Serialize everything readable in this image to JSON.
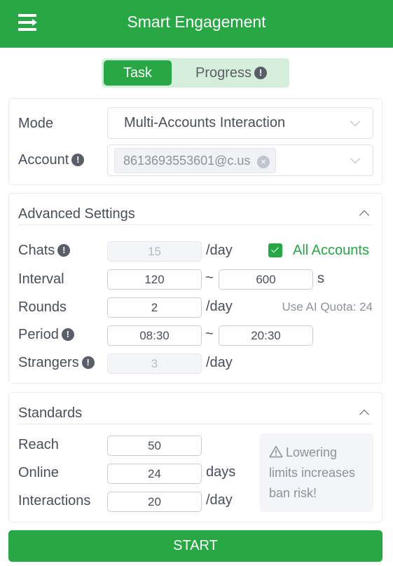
{
  "header": {
    "title": "Smart Engagement",
    "menu_icon": "menu-expand-icon"
  },
  "tabs": [
    {
      "label": "Task",
      "active": true
    },
    {
      "label": "Progress",
      "active": false,
      "badge": "!"
    }
  ],
  "basic": {
    "mode_label": "Mode",
    "mode_value": "Multi-Accounts Interaction",
    "account_label": "Account",
    "account_badge": "!",
    "account_tag": "8613693553601@c.us",
    "tag_close": "×"
  },
  "advanced": {
    "title": "Advanced Settings",
    "chats": {
      "label": "Chats",
      "badge": "!",
      "value": "15",
      "unit": "/day",
      "disabled": true
    },
    "all_accounts": {
      "label": "All Accounts",
      "checked": true
    },
    "interval": {
      "label": "Interval",
      "min": "120",
      "sep": "~",
      "max": "600",
      "unit": "s"
    },
    "rounds": {
      "label": "Rounds",
      "value": "2",
      "unit": "/day"
    },
    "quota": "Use AI Quota: 24",
    "period": {
      "label": "Period",
      "badge": "!",
      "start": "08:30",
      "sep": "~",
      "end": "20:30"
    },
    "strangers": {
      "label": "Strangers",
      "badge": "!",
      "value": "3",
      "unit": "/day",
      "disabled": true
    }
  },
  "standards": {
    "title": "Standards",
    "reach": {
      "label": "Reach",
      "value": "50"
    },
    "online": {
      "label": "Online",
      "value": "24",
      "unit": "days"
    },
    "interactions": {
      "label": "Interactions",
      "value": "20",
      "unit": "/day"
    },
    "warning": "Lowering limits increases ban risk!"
  },
  "actions": {
    "start_label": "START"
  },
  "colors": {
    "brand": "#28a745",
    "tab_bg": "#d5eedb",
    "muted": "#8e9299"
  }
}
